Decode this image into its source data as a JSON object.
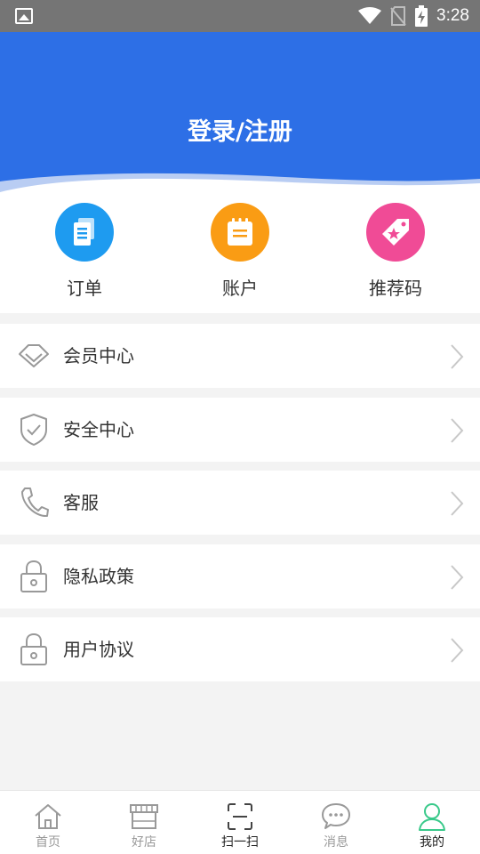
{
  "status_bar": {
    "time": "3:28"
  },
  "header": {
    "title": "登录/注册",
    "bg_color": "#2d6fe6"
  },
  "quick_actions": [
    {
      "label": "订单",
      "icon": "document-icon",
      "color": "#1e9bf0"
    },
    {
      "label": "账户",
      "icon": "notepad-icon",
      "color": "#fa9c14"
    },
    {
      "label": "推荐码",
      "icon": "tag-icon",
      "color": "#f04b96"
    }
  ],
  "menu": [
    {
      "label": "会员中心",
      "icon": "diamond-icon"
    },
    {
      "label": "安全中心",
      "icon": "shield-check-icon"
    },
    {
      "label": "客服",
      "icon": "phone-icon"
    },
    {
      "label": "隐私政策",
      "icon": "lock-icon"
    },
    {
      "label": "用户协议",
      "icon": "lock-icon"
    }
  ],
  "tabs": [
    {
      "label": "首页",
      "icon": "home-icon"
    },
    {
      "label": "好店",
      "icon": "shop-icon"
    },
    {
      "label": "扫一扫",
      "icon": "scan-icon"
    },
    {
      "label": "消息",
      "icon": "message-icon"
    },
    {
      "label": "我的",
      "icon": "user-icon",
      "active": true
    }
  ],
  "colors": {
    "active_tab": "#39c98a",
    "chevron": "#c8c8c8"
  }
}
